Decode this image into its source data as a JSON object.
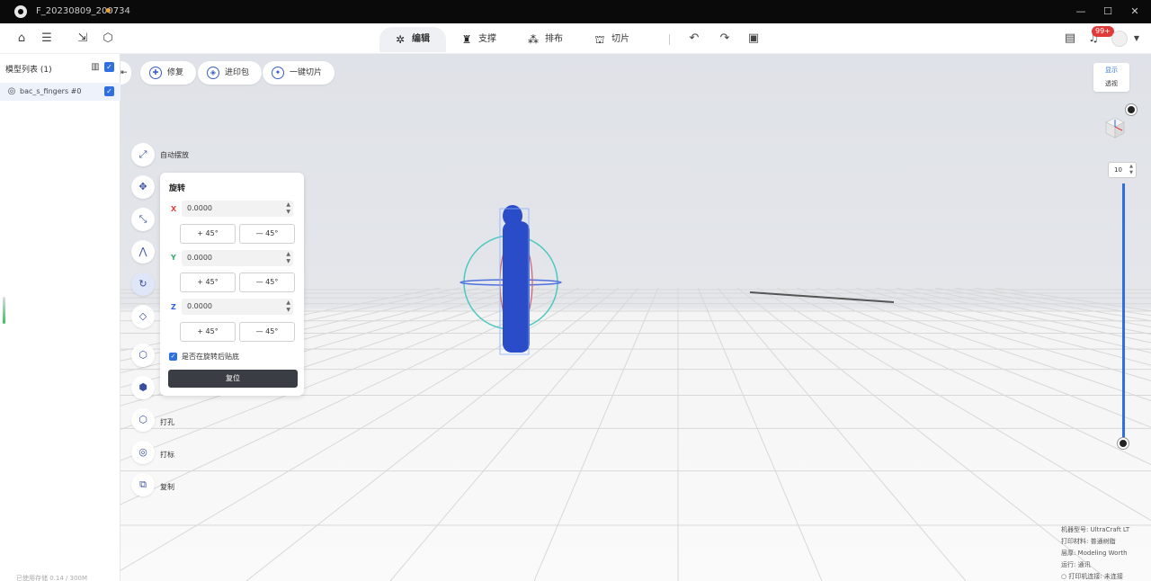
{
  "window": {
    "file_title": "F_20230809_200734",
    "minimize": "—",
    "maximize": "☐",
    "close": "✕"
  },
  "toolbar": {
    "tabs": [
      {
        "label": "编辑",
        "icon": "gear-icon"
      },
      {
        "label": "支撑",
        "icon": "support-icon"
      },
      {
        "label": "排布",
        "icon": "layout-icon"
      },
      {
        "label": "切片",
        "icon": "slice-icon"
      }
    ],
    "notification_count": "99+"
  },
  "sidebar": {
    "title": "模型列表 (1)",
    "model_name": "bac_s_fingers #0",
    "footer": "已使用存储 0.14 / 300M"
  },
  "viewport": {
    "top_actions": [
      {
        "label": "修复"
      },
      {
        "label": "进印包"
      },
      {
        "label": "一键切片"
      }
    ],
    "tools": [
      {
        "name": "auto-place",
        "label": "自动摆放"
      },
      {
        "name": "move",
        "label": ""
      },
      {
        "name": "scale",
        "label": ""
      },
      {
        "name": "mirror",
        "label": ""
      },
      {
        "name": "rotate",
        "label": ""
      },
      {
        "name": "lay-flat",
        "label": ""
      },
      {
        "name": "cube-tool",
        "label": ""
      },
      {
        "name": "hollow",
        "label": ""
      },
      {
        "name": "punch",
        "label": "打孔"
      },
      {
        "name": "mark",
        "label": "打标"
      },
      {
        "name": "copy",
        "label": "复制"
      }
    ],
    "rotation_panel": {
      "title": "旋转",
      "axes": [
        {
          "label": "X",
          "value": "0.0000",
          "plus": "+ 45°",
          "minus": "— 45°",
          "color": "#e04040"
        },
        {
          "label": "Y",
          "value": "0.0000",
          "plus": "+ 45°",
          "minus": "— 45°",
          "color": "#30b070"
        },
        {
          "label": "Z",
          "value": "0.0000",
          "plus": "+ 45°",
          "minus": "— 45°",
          "color": "#3060e0"
        }
      ],
      "checkbox_label": "是否在旋转后贴底",
      "reset_label": "复位"
    },
    "view_toggle": {
      "top": "显示",
      "bottom": "透视"
    },
    "zoom_value": "10",
    "info_lines": [
      "机器型号: UltraCraft LT",
      "打印材料: 普通树脂",
      "层厚: Modeling Worth",
      "运行: 通讯",
      "○ 打印机连接: 未连接"
    ]
  }
}
